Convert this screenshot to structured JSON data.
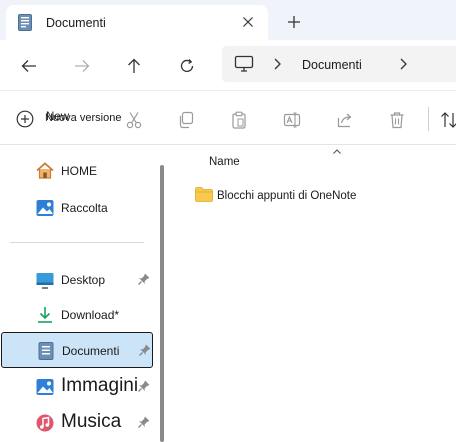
{
  "tab": {
    "title": "Documenti",
    "close_glyph": "✕",
    "new_tab_glyph": "+"
  },
  "nav": {
    "back_icon": "arrow-left-icon",
    "forward_icon": "arrow-right-icon",
    "up_icon": "arrow-up-icon",
    "refresh_icon": "refresh-icon"
  },
  "address": {
    "root_icon": "computer-icon",
    "segment": "Documenti"
  },
  "toolbar": {
    "new_label": "New",
    "tooltip": "Nuova versione",
    "buttons": [
      "cut-icon",
      "copy-icon",
      "paste-icon",
      "rename-icon",
      "share-icon",
      "delete-icon",
      "sort-icon"
    ]
  },
  "sidebar": {
    "items": [
      {
        "label": "HOME",
        "icon": "home-icon"
      },
      {
        "label": "Raccolta",
        "icon": "gallery-icon"
      },
      {
        "label": "Desktop",
        "icon": "desktop-icon",
        "pinned": true
      },
      {
        "label": "Download*",
        "icon": "download-icon",
        "pinned": false
      },
      {
        "label": "Documenti",
        "icon": "documents-icon",
        "pinned": true,
        "selected": true
      },
      {
        "label": "Immagini",
        "icon": "pictures-icon",
        "pinned": true
      },
      {
        "label": "Musica",
        "icon": "music-icon",
        "pinned": true
      }
    ]
  },
  "content": {
    "column_header": "Name",
    "rows": [
      {
        "name": "Blocchi appunti di OneNote",
        "icon": "folder-icon"
      }
    ]
  },
  "colors": {
    "accent": "#005fb8",
    "selected_bg": "#cce4f7",
    "tabbar_bg": "#f0f3f9",
    "folder": "#f8c94a"
  }
}
